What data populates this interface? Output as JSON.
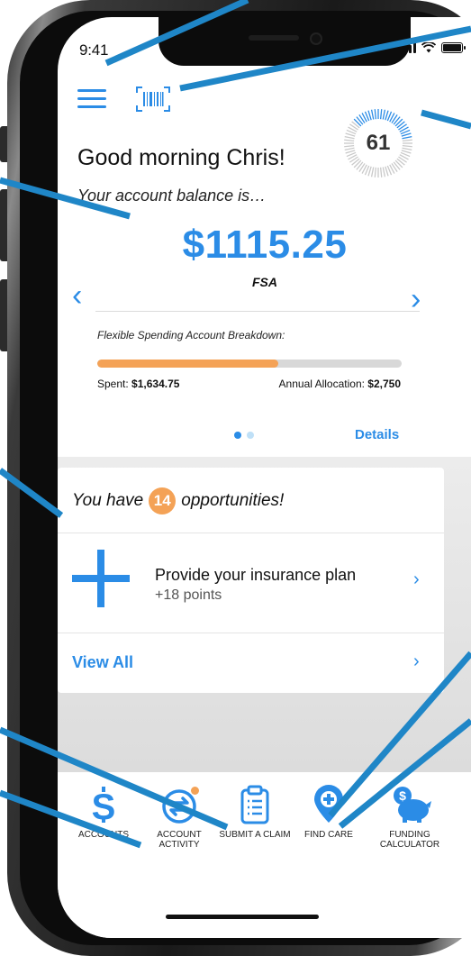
{
  "status_bar": {
    "time": "9:41"
  },
  "header": {
    "menu_icon": "hamburger-menu-icon",
    "barcode_icon": "barcode-icon",
    "score": "61",
    "greeting": "Good morning Chris!",
    "balance_intro": "Your account balance is…"
  },
  "balance_card": {
    "amount": "$1115.25",
    "account_type": "FSA",
    "breakdown_label": "Flexible Spending Account Breakdown:",
    "spent_label": "Spent:",
    "spent_value": "$1,634.75",
    "allocation_label": "Annual Allocation:",
    "allocation_value": "$2,750",
    "progress_fraction": 0.594,
    "page_index": 1,
    "page_count": 2,
    "details_label": "Details"
  },
  "opportunities": {
    "prefix": "You have",
    "count": "14",
    "suffix": "opportunities!",
    "items": [
      {
        "title": "Provide your insurance plan",
        "points": "+18 points"
      }
    ],
    "view_all_label": "View All"
  },
  "tabbar": {
    "tabs": [
      {
        "label": "ACCOUNTS",
        "icon": "dollar-icon"
      },
      {
        "label": "ACCOUNT ACTIVITY",
        "icon": "transfer-arrows-icon",
        "has_notification": true
      },
      {
        "label": "SUBMIT A CLAIM",
        "icon": "clipboard-icon"
      },
      {
        "label": "FIND CARE",
        "icon": "map-pin-plus-icon"
      },
      {
        "label": "FUNDING CALCULATOR",
        "icon": "piggy-bank-icon"
      }
    ]
  },
  "colors": {
    "accent": "#2b8ce6",
    "progress": "#f4a256",
    "callout": "#1f86c7"
  }
}
